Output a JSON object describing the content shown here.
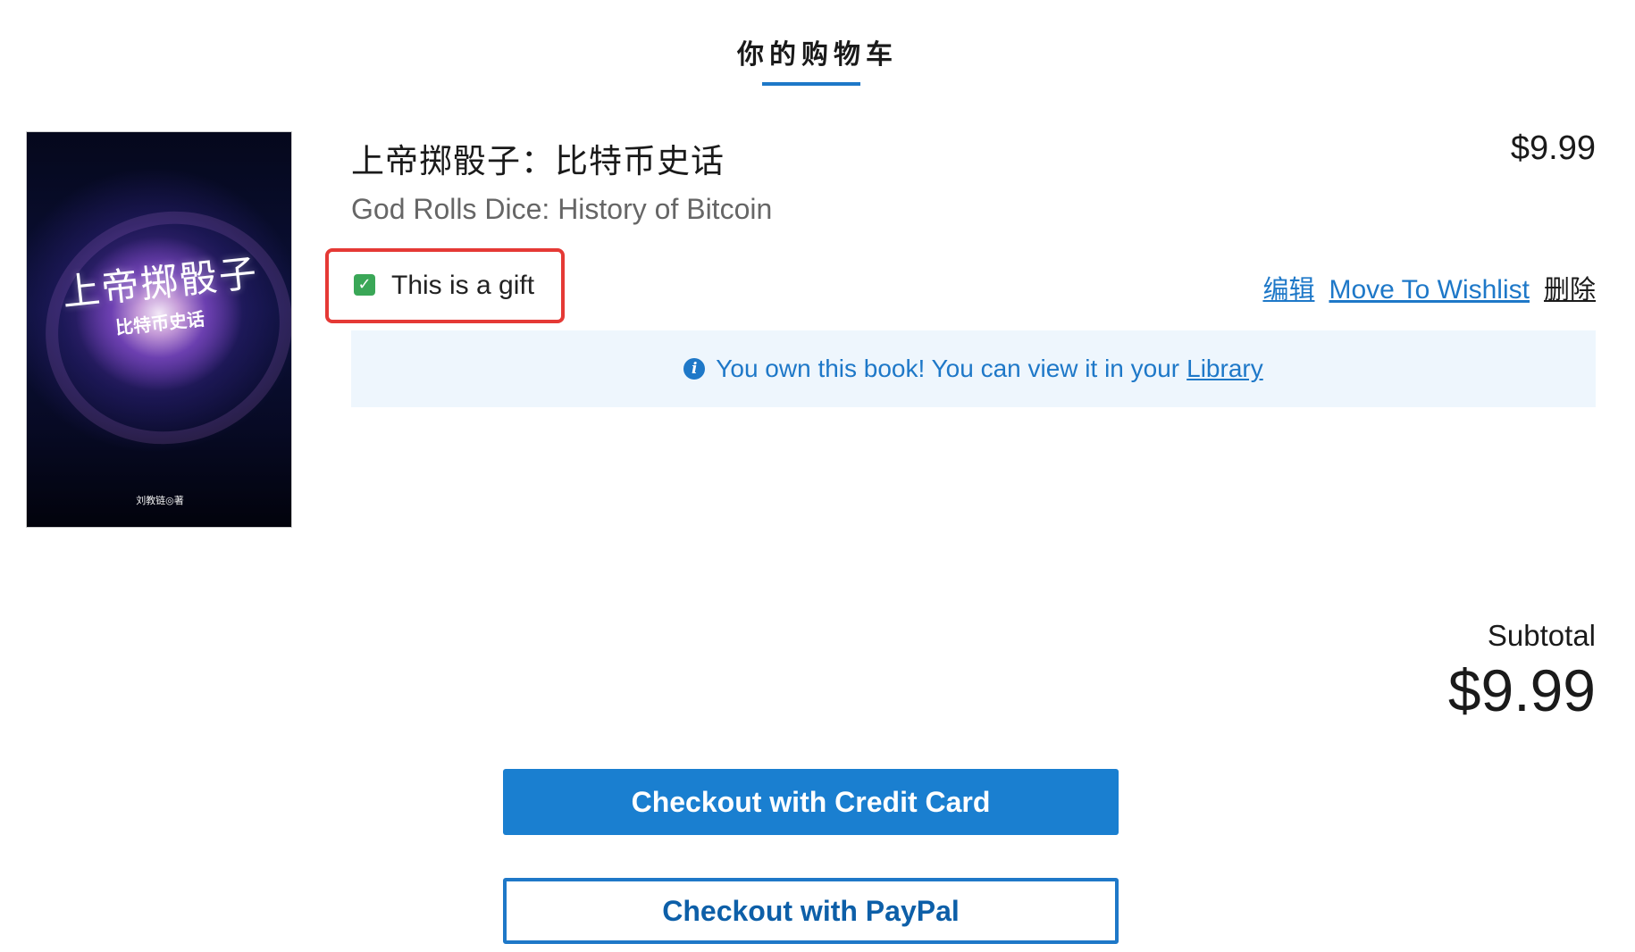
{
  "header": {
    "title": "你的购物车"
  },
  "item": {
    "cover": {
      "title": "上帝掷骰子",
      "subtitle": "比特币史话",
      "author": "刘教链◎著"
    },
    "title": "上帝掷骰子：比特币史话",
    "subtitle": "God Rolls Dice: History of Bitcoin",
    "price": "$9.99",
    "gift": {
      "label": "This is a gift",
      "checked": true,
      "check_glyph": "✓"
    },
    "actions": {
      "edit": "编辑",
      "move_to_wishlist": "Move To Wishlist",
      "delete": "删除"
    },
    "notice": {
      "icon": "info-icon",
      "icon_glyph": "i",
      "text": "You own this book! You can view it in your",
      "link": "Library"
    }
  },
  "summary": {
    "subtotal_label": "Subtotal",
    "subtotal_value": "$9.99"
  },
  "checkout": {
    "credit_card_label": "Checkout with Credit Card",
    "paypal_label": "Checkout with PayPal"
  },
  "colors": {
    "accent": "#1e78c8",
    "highlight": "#e53935",
    "checkbox": "#3aa757",
    "notice_bg": "#eef6fd"
  }
}
